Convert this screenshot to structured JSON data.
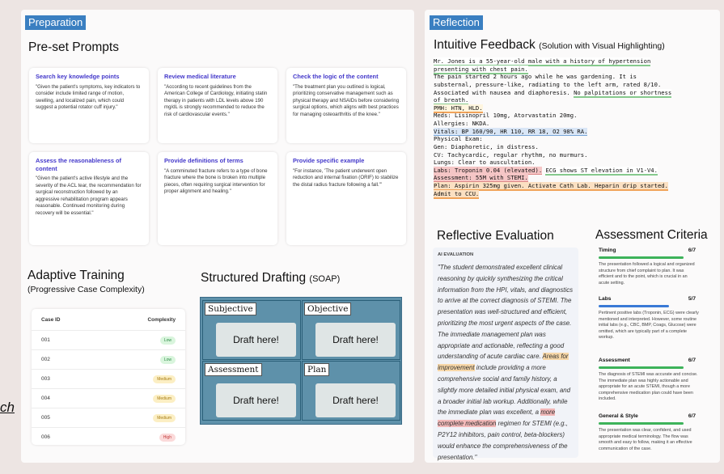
{
  "prep": {
    "label": "Preparation",
    "prompts_title": "Pre-set Prompts",
    "cards": [
      {
        "title": "Search key knowledge points",
        "body": "\"Given the patient's symptoms, key indicators to consider include limited range of motion, swelling, and localized pain, which could suggest a potential rotator cuff injury.\""
      },
      {
        "title": "Review medical literature",
        "body": "\"According to recent guidelines from the American College of Cardiology, initiating statin therapy in patients with LDL levels above 190 mg/dL is strongly recommended to reduce the risk of cardiovascular events.\""
      },
      {
        "title": "Check the logic of the content",
        "body": "\"The treatment plan you outlined is logical, prioritizing conservative management such as physical therapy and NSAIDs before considering surgical options, which aligns with best practices for managing osteoarthritis of the knee.\""
      },
      {
        "title": "Assess the reasonableness of content",
        "body": "\"Given the patient's active lifestyle and the severity of the ACL tear, the recommendation for surgical reconstruction followed by an aggressive rehabilitation program appears reasonable. Continued monitoring during recovery will be essential.\""
      },
      {
        "title": "Provide definitions of terms",
        "body": "\"A comminuted fracture refers to a type of bone fracture where the bone is broken into multiple pieces, often requiring surgical intervention for proper alignment and healing.\""
      },
      {
        "title": "Provide specific example",
        "body": "\"For instance, 'The patient underwent open reduction and internal fixation (ORIF) to stabilize the distal radius fracture following a fall.'\""
      }
    ]
  },
  "adaptive": {
    "title": "Adaptive Training",
    "subtitle": "(Progressive Case Complexity)",
    "col_id": "Case ID",
    "col_complexity": "Complexity",
    "rows": [
      {
        "id": "001",
        "level": "Low"
      },
      {
        "id": "002",
        "level": "Low"
      },
      {
        "id": "003",
        "level": "Medium"
      },
      {
        "id": "004",
        "level": "Medium"
      },
      {
        "id": "005",
        "level": "Medium"
      },
      {
        "id": "006",
        "level": "High"
      }
    ]
  },
  "soap": {
    "title": "Structured Drafting",
    "title_suffix": "(SOAP)",
    "subjective": "Subjective",
    "objective": "Objective",
    "assessment": "Assessment",
    "plan": "Plan",
    "draft": "Draft here!"
  },
  "edge_text": "ch",
  "reflection": {
    "label": "Reflection",
    "feedback_title": "Intuitive Feedback",
    "feedback_suffix": "(Solution with Visual Highlighting)",
    "case": {
      "l1": "Mr. Jones is a 55-year-old male with a history of hypertension",
      "l2": "presenting with chest pain.",
      "l3": "The pain started 2 hours ago while he was gardening. It is",
      "l4": "substernal, pressure-like, radiating to the left arm, rated 8/10.",
      "l5a": "Associated with nausea and diaphoresis. ",
      "l5b": "No palpitations or shortness",
      "l6": "of breath.",
      "l7": "PMH: HTN, HLD.",
      "l8": "Meds: Lisinopril 10mg, Atorvastatin 20mg.",
      "l9": "Allergies: NKDA.",
      "l10": "Vitals: BP 160/90, HR 110, RR 18, O2 98% RA.",
      "l11": "Physical Exam:",
      "l12": "Gen: Diaphoretic, in distress.",
      "l13": "CV: Tachycardic, regular rhythm, no murmurs.",
      "l14": "Lungs: Clear to auscultation.",
      "l15a": "Labs: Troponin 0.04 (elevated).",
      "l15b": "ECG shows ST elevation in V1-V4.",
      "l16": "Assessment: 55M with STEMI.",
      "l17": "Plan: Aspirin 325mg given. Activate Cath Lab. Heparin drip started.",
      "l18": "Admit to CCU."
    },
    "eval_title": "Reflective Evaluation",
    "ai_label": "AI EVALUATION",
    "eval_a": "\"The student demonstrated excellent clinical reasoning by quickly synthesizing the critical information from the HPI, vitals, and diagnostics to arrive at the correct diagnosis of STEMI. The presentation was well-structured and efficient, prioritizing the most urgent aspects of the case. The immediate management plan was appropriate and actionable, reflecting a good understanding of acute cardiac care. ",
    "eval_mark1": "Areas for improvement",
    "eval_b": " include providing a more comprehensive social and family history, a slightly more detailed initial physical exam, and a broader initial lab workup. Additionally, while the immediate plan was excellent, a ",
    "eval_mark2": "more complete medication",
    "eval_c": " regimen for STEMI (e.g., P2Y12 inhibitors, pain control, beta-blockers) would enhance the comprehensiveness of the presentation.\"",
    "criteria_title": "Assessment Criteria",
    "criteria": [
      {
        "name": "Timing",
        "score": "6/7",
        "fill": 0.86,
        "color": "#3db35a",
        "desc": "The presentation followed a logical and organized structure from chief complaint to plan. It was efficient and to the point, which is crucial in an acute setting."
      },
      {
        "name": "Labs",
        "score": "5/7",
        "fill": 0.71,
        "color": "#3a7ad6",
        "desc": "Pertinent positive labs (Troponin, ECG) were clearly mentioned and interpreted. However, some routine initial labs (e.g., CBC, BMP, Coags, Glucose) were omitted, which are typically part of a complete workup."
      },
      {
        "name": "Assessment",
        "score": "6/7",
        "fill": 0.86,
        "color": "#3db35a",
        "desc": "The diagnosis of STEMI was accurate and concise. The immediate plan was highly actionable and appropriate for an acute STEMI, though a more comprehensive medication plan could have been included."
      },
      {
        "name": "General & Style",
        "score": "6/7",
        "fill": 0.86,
        "color": "#3db35a",
        "desc": "The presentation was clear, confident, and used appropriate medical terminology. The flow was smooth and easy to follow, making it an effective communication of the case."
      }
    ]
  }
}
